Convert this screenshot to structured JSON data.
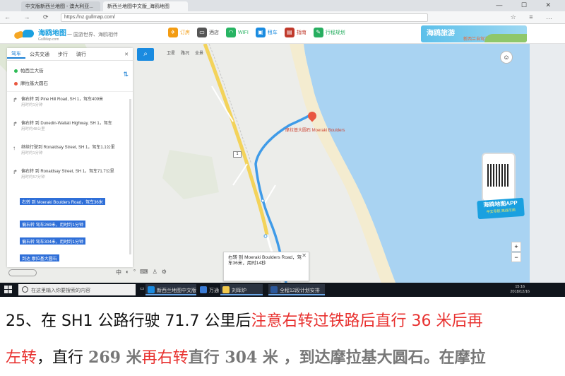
{
  "browser": {
    "tabs": [
      "中文版新西兰地图 - 澳大利亚...",
      "新西兰地图中文版_海鸥地图"
    ],
    "url": "https://nz.gullmap.com/"
  },
  "site": {
    "logo_text": "海鸥地图",
    "logo_sub": "GullMap.com",
    "slogan": "一 国游世界、海鸥相伴",
    "nav": [
      {
        "label": "订房",
        "color": "#f39c12",
        "icon": "plane"
      },
      {
        "label": "酒店",
        "color": "#555555",
        "icon": "bed"
      },
      {
        "label": "WIFI",
        "color": "#28b463",
        "icon": "wifi"
      },
      {
        "label": "租车",
        "color": "#1a8be0",
        "icon": "car"
      },
      {
        "label": "指南",
        "color": "#c0392b",
        "icon": "book"
      },
      {
        "label": "行程规划",
        "color": "#27ae60",
        "icon": "plan"
      }
    ],
    "banner_title": "海鸥旅游",
    "banner_sub": "新西兰自驾游行程规划"
  },
  "panel": {
    "modes": [
      "驾车",
      "公共交通",
      "步行",
      "骑行"
    ],
    "close": "✕",
    "start": "帕西兰大街",
    "end": "摩拉基大圆石",
    "steps": [
      {
        "text": "偏右转 到 Pine Hill Road, SH 1，驾车409米",
        "sub": "用时约1分钟"
      },
      {
        "text": "偏右转 到 Dunedin-Waitati Highway, SH 1，驾车",
        "sub": "用时约48公里"
      },
      {
        "text": "继续行驶到 Ronaldsay Street, SH 1，驾车1.1公里",
        "sub": "用时约1分钟"
      },
      {
        "text": "偏右转 到 Ronaldsay Street, SH 1，驾车71.7公里",
        "sub": "用时约57分钟"
      }
    ],
    "highlights": [
      "右转 到 Moeraki Boulders Road，驾车36米",
      "偏右转 驾车269米，用时约1分钟",
      "偏右转 驾车304米，用时约1分钟",
      "到达 摩拉基大圆石"
    ]
  },
  "map": {
    "toggle": [
      "卫星",
      "路况",
      "全景"
    ],
    "poi_label": "摩拉基大圆石 Moeraki Boulders",
    "road_badge": "1",
    "popup_text": "右转 到 Moeraki Boulders Road，驾车36米，用时14秒",
    "qr_caption": "海鸥地图APP",
    "qr_sub": "中文导航 离线可用",
    "zoom_in": "+",
    "zoom_out": "−"
  },
  "taskbar": {
    "search_placeholder": "在这里输入你要搜索的内容",
    "apps": [
      "新西兰地图中文版",
      "万通",
      "刘晖炉",
      "全程12段计划安排"
    ],
    "time": "15:16",
    "date": "2018/12/16"
  },
  "caption": {
    "line1_prefix": "25、在 SH1 公路行驶 71.7 公里后",
    "line1_red": "注意右转过铁路后直行 36 米后再",
    "line2_red": "左转",
    "line2_a": "，直行 ",
    "line2_num1": "269",
    "line2_b": " 米",
    "line2_red2": "再右转",
    "line2_c": "直行 ",
    "line2_num2": "304",
    "line2_d": " 米 ，到达摩拉基大圆石。在摩拉"
  }
}
